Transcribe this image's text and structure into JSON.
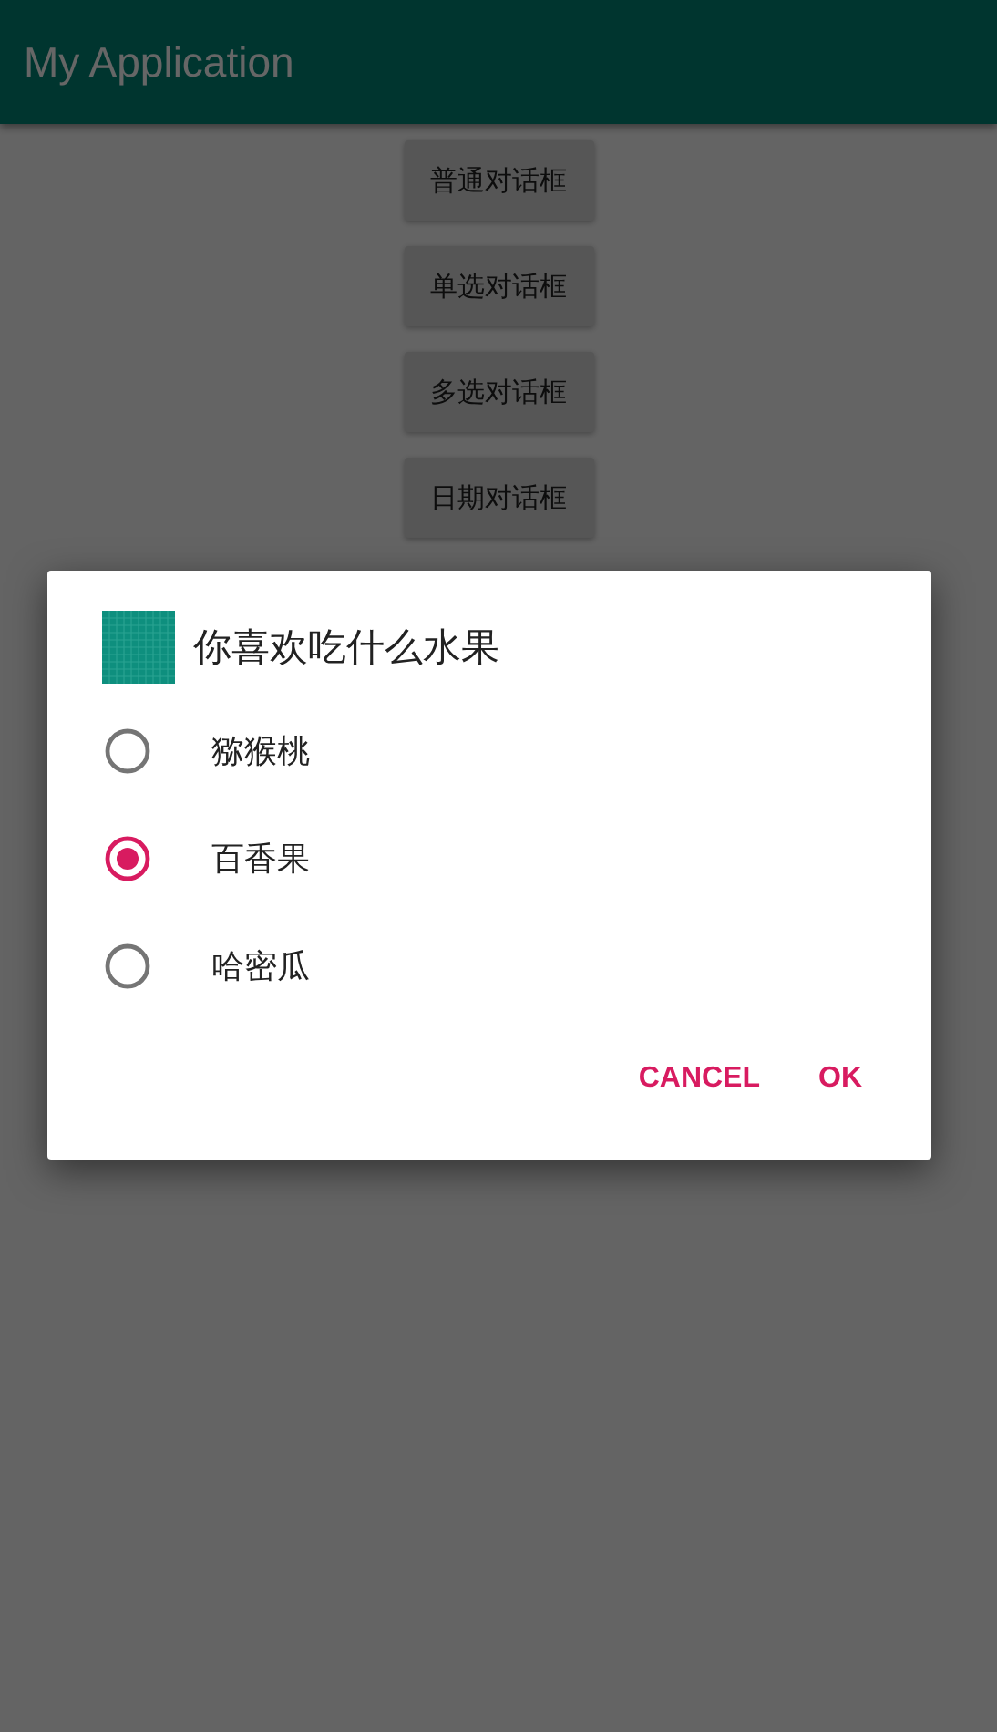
{
  "app_bar": {
    "title": "My Application"
  },
  "buttons": [
    "普通对话框",
    "单选对话框",
    "多选对话框",
    "日期对话框"
  ],
  "dialog": {
    "title": "你喜欢吃什么水果",
    "options": [
      {
        "label": "猕猴桃",
        "selected": false
      },
      {
        "label": "百香果",
        "selected": true
      },
      {
        "label": "哈密瓜",
        "selected": false
      }
    ],
    "actions": [
      "CANCEL",
      "OK"
    ]
  }
}
